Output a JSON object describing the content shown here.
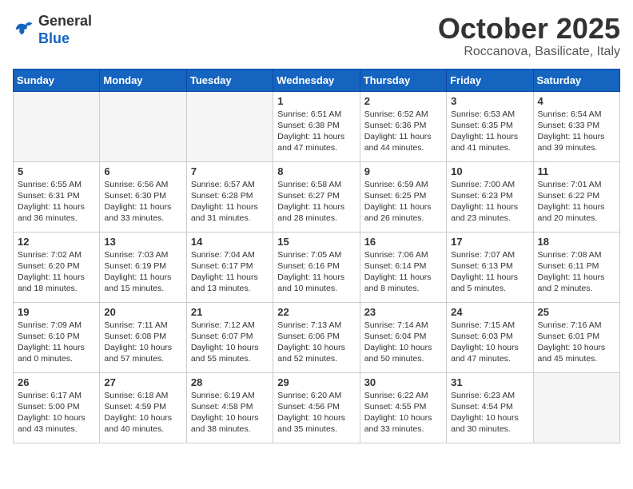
{
  "header": {
    "logo_general": "General",
    "logo_blue": "Blue",
    "month_title": "October 2025",
    "location": "Roccanova, Basilicate, Italy"
  },
  "days_of_week": [
    "Sunday",
    "Monday",
    "Tuesday",
    "Wednesday",
    "Thursday",
    "Friday",
    "Saturday"
  ],
  "weeks": [
    [
      {
        "day": "",
        "info": ""
      },
      {
        "day": "",
        "info": ""
      },
      {
        "day": "",
        "info": ""
      },
      {
        "day": "1",
        "info": "Sunrise: 6:51 AM\nSunset: 6:38 PM\nDaylight: 11 hours\nand 47 minutes."
      },
      {
        "day": "2",
        "info": "Sunrise: 6:52 AM\nSunset: 6:36 PM\nDaylight: 11 hours\nand 44 minutes."
      },
      {
        "day": "3",
        "info": "Sunrise: 6:53 AM\nSunset: 6:35 PM\nDaylight: 11 hours\nand 41 minutes."
      },
      {
        "day": "4",
        "info": "Sunrise: 6:54 AM\nSunset: 6:33 PM\nDaylight: 11 hours\nand 39 minutes."
      }
    ],
    [
      {
        "day": "5",
        "info": "Sunrise: 6:55 AM\nSunset: 6:31 PM\nDaylight: 11 hours\nand 36 minutes."
      },
      {
        "day": "6",
        "info": "Sunrise: 6:56 AM\nSunset: 6:30 PM\nDaylight: 11 hours\nand 33 minutes."
      },
      {
        "day": "7",
        "info": "Sunrise: 6:57 AM\nSunset: 6:28 PM\nDaylight: 11 hours\nand 31 minutes."
      },
      {
        "day": "8",
        "info": "Sunrise: 6:58 AM\nSunset: 6:27 PM\nDaylight: 11 hours\nand 28 minutes."
      },
      {
        "day": "9",
        "info": "Sunrise: 6:59 AM\nSunset: 6:25 PM\nDaylight: 11 hours\nand 26 minutes."
      },
      {
        "day": "10",
        "info": "Sunrise: 7:00 AM\nSunset: 6:23 PM\nDaylight: 11 hours\nand 23 minutes."
      },
      {
        "day": "11",
        "info": "Sunrise: 7:01 AM\nSunset: 6:22 PM\nDaylight: 11 hours\nand 20 minutes."
      }
    ],
    [
      {
        "day": "12",
        "info": "Sunrise: 7:02 AM\nSunset: 6:20 PM\nDaylight: 11 hours\nand 18 minutes."
      },
      {
        "day": "13",
        "info": "Sunrise: 7:03 AM\nSunset: 6:19 PM\nDaylight: 11 hours\nand 15 minutes."
      },
      {
        "day": "14",
        "info": "Sunrise: 7:04 AM\nSunset: 6:17 PM\nDaylight: 11 hours\nand 13 minutes."
      },
      {
        "day": "15",
        "info": "Sunrise: 7:05 AM\nSunset: 6:16 PM\nDaylight: 11 hours\nand 10 minutes."
      },
      {
        "day": "16",
        "info": "Sunrise: 7:06 AM\nSunset: 6:14 PM\nDaylight: 11 hours\nand 8 minutes."
      },
      {
        "day": "17",
        "info": "Sunrise: 7:07 AM\nSunset: 6:13 PM\nDaylight: 11 hours\nand 5 minutes."
      },
      {
        "day": "18",
        "info": "Sunrise: 7:08 AM\nSunset: 6:11 PM\nDaylight: 11 hours\nand 2 minutes."
      }
    ],
    [
      {
        "day": "19",
        "info": "Sunrise: 7:09 AM\nSunset: 6:10 PM\nDaylight: 11 hours\nand 0 minutes."
      },
      {
        "day": "20",
        "info": "Sunrise: 7:11 AM\nSunset: 6:08 PM\nDaylight: 10 hours\nand 57 minutes."
      },
      {
        "day": "21",
        "info": "Sunrise: 7:12 AM\nSunset: 6:07 PM\nDaylight: 10 hours\nand 55 minutes."
      },
      {
        "day": "22",
        "info": "Sunrise: 7:13 AM\nSunset: 6:06 PM\nDaylight: 10 hours\nand 52 minutes."
      },
      {
        "day": "23",
        "info": "Sunrise: 7:14 AM\nSunset: 6:04 PM\nDaylight: 10 hours\nand 50 minutes."
      },
      {
        "day": "24",
        "info": "Sunrise: 7:15 AM\nSunset: 6:03 PM\nDaylight: 10 hours\nand 47 minutes."
      },
      {
        "day": "25",
        "info": "Sunrise: 7:16 AM\nSunset: 6:01 PM\nDaylight: 10 hours\nand 45 minutes."
      }
    ],
    [
      {
        "day": "26",
        "info": "Sunrise: 6:17 AM\nSunset: 5:00 PM\nDaylight: 10 hours\nand 43 minutes."
      },
      {
        "day": "27",
        "info": "Sunrise: 6:18 AM\nSunset: 4:59 PM\nDaylight: 10 hours\nand 40 minutes."
      },
      {
        "day": "28",
        "info": "Sunrise: 6:19 AM\nSunset: 4:58 PM\nDaylight: 10 hours\nand 38 minutes."
      },
      {
        "day": "29",
        "info": "Sunrise: 6:20 AM\nSunset: 4:56 PM\nDaylight: 10 hours\nand 35 minutes."
      },
      {
        "day": "30",
        "info": "Sunrise: 6:22 AM\nSunset: 4:55 PM\nDaylight: 10 hours\nand 33 minutes."
      },
      {
        "day": "31",
        "info": "Sunrise: 6:23 AM\nSunset: 4:54 PM\nDaylight: 10 hours\nand 30 minutes."
      },
      {
        "day": "",
        "info": ""
      }
    ]
  ]
}
